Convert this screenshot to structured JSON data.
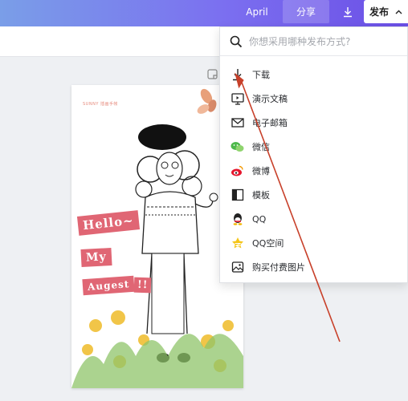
{
  "topbar": {
    "project_name": "April",
    "share_label": "分享",
    "publish_label": "发布"
  },
  "canvas": {
    "brand_text": "SUNNY 插画手帐",
    "sticker_hello": "Hello~",
    "sticker_my": "My",
    "sticker_august": "Augest",
    "sticker_bang": "!!"
  },
  "publish_menu": {
    "search_placeholder": "你想采用哪种发布方式?",
    "items": [
      {
        "label": "下载",
        "icon": "download-icon"
      },
      {
        "label": "演示文稿",
        "icon": "presentation-icon"
      },
      {
        "label": "电子邮箱",
        "icon": "email-icon"
      },
      {
        "label": "微信",
        "icon": "wechat-icon"
      },
      {
        "label": "微博",
        "icon": "weibo-icon"
      },
      {
        "label": "模板",
        "icon": "template-icon"
      },
      {
        "label": "QQ",
        "icon": "qq-icon"
      },
      {
        "label": "QQ空间",
        "icon": "qzone-icon"
      },
      {
        "label": "购买付费图片",
        "icon": "image-icon"
      }
    ]
  },
  "colors": {
    "annotation_arrow": "#c8402a",
    "sticker_pink": "#e06674"
  }
}
